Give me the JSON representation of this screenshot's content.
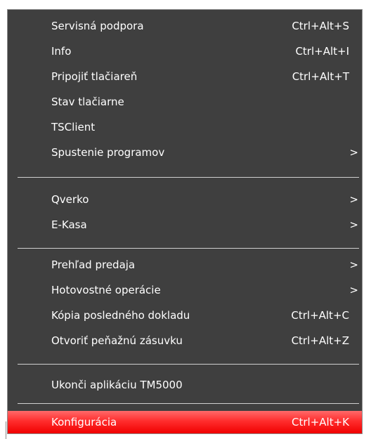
{
  "menu": {
    "items": [
      {
        "label": "Servisná podpora",
        "shortcut": "Ctrl+Alt+S",
        "arrow": ""
      },
      {
        "label": "Info",
        "shortcut": "Ctrl+Alt+I",
        "arrow": ""
      },
      {
        "label": "Pripojiť tlačiareň",
        "shortcut": "Ctrl+Alt+T",
        "arrow": ""
      },
      {
        "label": "Stav tlačiarne",
        "shortcut": "",
        "arrow": ""
      },
      {
        "label": "TSClient",
        "shortcut": "",
        "arrow": ""
      },
      {
        "label": "Spustenie programov",
        "shortcut": "",
        "arrow": ">"
      },
      {
        "label": "Qverko",
        "shortcut": "",
        "arrow": ">"
      },
      {
        "label": "E-Kasa",
        "shortcut": "",
        "arrow": ">"
      },
      {
        "label": "Prehľad predaja",
        "shortcut": "",
        "arrow": ">"
      },
      {
        "label": "Hotovostné operácie",
        "shortcut": "",
        "arrow": ">"
      },
      {
        "label": "Kópia posledného dokladu",
        "shortcut": "Ctrl+Alt+C",
        "arrow": ""
      },
      {
        "label": "Otvoriť peňažnú zásuvku",
        "shortcut": "Ctrl+Alt+Z",
        "arrow": ""
      },
      {
        "label": "Ukonči aplikáciu TM5000",
        "shortcut": "",
        "arrow": ""
      },
      {
        "label": "Konfigurácia",
        "shortcut": "Ctrl+Alt+K",
        "arrow": ""
      }
    ],
    "selected_label": "Konfigurácia",
    "colors": {
      "background": "#3f3f3f",
      "text": "#ffffff",
      "highlight": "#ff2d2d",
      "separator": "#d0d0d0"
    }
  }
}
